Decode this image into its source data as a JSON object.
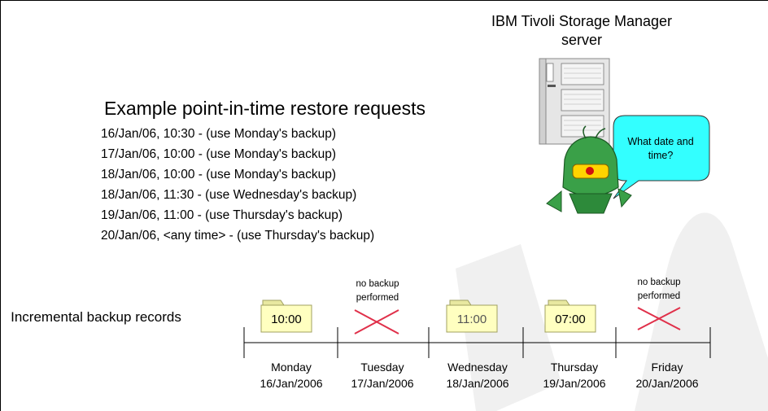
{
  "server": {
    "title": "IBM Tivoli Storage Manager server"
  },
  "speech_bubble": "What date and time?",
  "requests": {
    "title": "Example point-in-time restore requests",
    "items": [
      "16/Jan/06, 10:30 - (use Monday's backup)",
      "17/Jan/06, 10:00 - (use Monday's backup)",
      "18/Jan/06, 10:00 - (use Monday's backup)",
      "18/Jan/06, 11:30 - (use Wednesday's backup)",
      "19/Jan/06, 11:00 - (use Thursday's backup)",
      "20/Jan/06, <any time> - (use Thursday's backup)"
    ]
  },
  "timeline": {
    "label": "Incremental backup records",
    "days": [
      {
        "name": "Monday",
        "date": "16/Jan/2006",
        "backup": "10:00"
      },
      {
        "name": "Tuesday",
        "date": "17/Jan/2006",
        "note": "no backup performed"
      },
      {
        "name": "Wednesday",
        "date": "18/Jan/2006",
        "backup": "11:00"
      },
      {
        "name": "Thursday",
        "date": "19/Jan/2006",
        "backup": "07:00"
      },
      {
        "name": "Friday",
        "date": "20/Jan/2006",
        "note": "no backup performed"
      }
    ]
  },
  "colors": {
    "folder_fill": "#ffffc0",
    "folder_tab": "#e8e8a0",
    "cross": "#e0304a",
    "bubble": "#33ffff",
    "server": "#e6e6e6",
    "watermark": "#f2f2f2"
  }
}
